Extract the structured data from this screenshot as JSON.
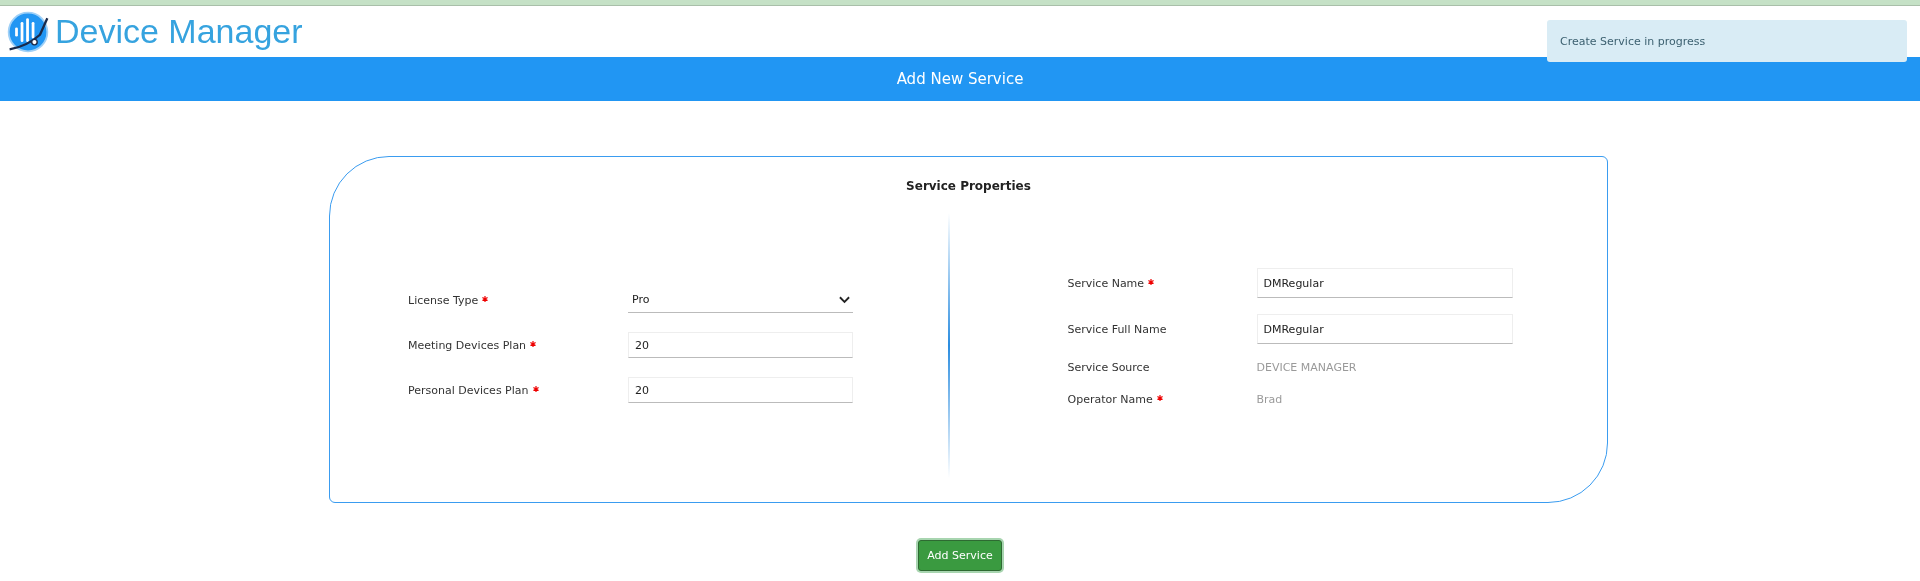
{
  "app": {
    "title": "Device Manager"
  },
  "toast": {
    "message": "Create Service in progress"
  },
  "banner": {
    "title": "Add New Service"
  },
  "card": {
    "title": "Service Properties",
    "left_fields": [
      {
        "kind": "select",
        "label": "License Type",
        "required": true,
        "value": "Pro"
      },
      {
        "kind": "input",
        "label": "Meeting Devices Plan",
        "required": true,
        "value": "20"
      },
      {
        "kind": "input",
        "label": "Personal Devices Plan",
        "required": true,
        "value": "20"
      }
    ],
    "right_fields": [
      {
        "kind": "input",
        "label": "Service Name",
        "required": true,
        "value": "DMRegular"
      },
      {
        "kind": "input",
        "label": "Service Full Name",
        "required": false,
        "value": "DMRegular"
      },
      {
        "kind": "static",
        "label": "Service Source",
        "required": false,
        "value": "DEVICE MANAGER"
      },
      {
        "kind": "static",
        "label": "Operator Name",
        "required": true,
        "value": "Brad"
      }
    ]
  },
  "buttons": [
    "Add Service"
  ]
}
